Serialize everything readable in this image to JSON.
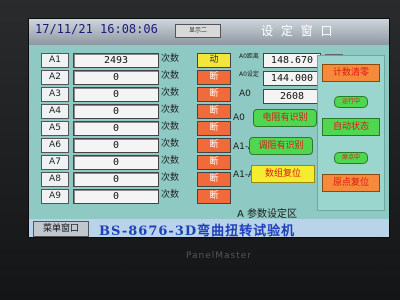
{
  "header": {
    "datetime": "17/11/21  16:08:06",
    "flag": "显示二",
    "title": "设 定 窗 口"
  },
  "rows": [
    {
      "label": "A1",
      "value": "2493",
      "unit": "次数",
      "status": "动"
    },
    {
      "label": "A2",
      "value": "0",
      "unit": "次数",
      "status": "断"
    },
    {
      "label": "A3",
      "value": "0",
      "unit": "次数",
      "status": "断"
    },
    {
      "label": "A4",
      "value": "0",
      "unit": "次数",
      "status": "断"
    },
    {
      "label": "A5",
      "value": "0",
      "unit": "次数",
      "status": "断"
    },
    {
      "label": "A6",
      "value": "0",
      "unit": "次数",
      "status": "断"
    },
    {
      "label": "A7",
      "value": "0",
      "unit": "次数",
      "status": "断"
    },
    {
      "label": "A8",
      "value": "0",
      "unit": "次数",
      "status": "断"
    },
    {
      "label": "A9",
      "value": "0",
      "unit": "次数",
      "status": "断"
    }
  ],
  "info": {
    "r1_label": "A0距离",
    "r1_value": "148.670",
    "r1_unit": "mm",
    "r2_label": "A0设定",
    "r2_value": "144.000",
    "r2_unit": "mm",
    "r3_label": "A0",
    "r3_value": "2608",
    "r3_unit": "次数"
  },
  "controls": {
    "grp1": "A0",
    "btn1": "电阻有识别",
    "grp2": "A1-A9",
    "btn2": "调阻有识别",
    "grp3": "A1-A9",
    "btn3": "数组复位",
    "param_area": "A  参数设定区"
  },
  "right_panel": {
    "btn_data": "计数清零",
    "ind_running": "运行中",
    "btn_auto": "自动状态",
    "ind_origin": "原点中",
    "btn_origin": "原点复位"
  },
  "footer": {
    "menu": "菜单窗口",
    "machine": "BS-8676-3D弯曲扭转试验机"
  },
  "bezel": {
    "brand": "PanelMaster"
  }
}
